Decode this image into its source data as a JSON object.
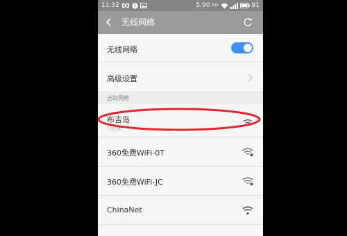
{
  "status_bar": {
    "time": "11:32",
    "speed": "5.90",
    "speed_unit": "K/s",
    "battery": "91",
    "icons": [
      "infinity-icon",
      "alert-icon",
      "image-icon",
      "wifi-icon",
      "signal-icon",
      "battery-icon"
    ]
  },
  "header": {
    "title": "无线网络",
    "back_icon": "back-arrow-icon",
    "refresh_icon": "refresh-icon"
  },
  "settings": {
    "wifi_toggle_label": "无线网络",
    "wifi_enabled": true,
    "advanced_label": "高级设置"
  },
  "section": {
    "choose_network_label": "选取网络"
  },
  "networks": [
    {
      "ssid": "布吉岛",
      "status": "已连接",
      "secured": false
    },
    {
      "ssid": "360免费WiFi-0T",
      "secured": true
    },
    {
      "ssid": "360免费WiFi-JC",
      "secured": true
    },
    {
      "ssid": "ChinaNet",
      "secured": false
    }
  ],
  "colors": {
    "status_bar": "#858585",
    "title_bar": "#9a9a9a",
    "toggle_on": "#3f8ff0",
    "highlight": "#e2262c",
    "background": "#ececec",
    "row": "#f7f7f7"
  }
}
